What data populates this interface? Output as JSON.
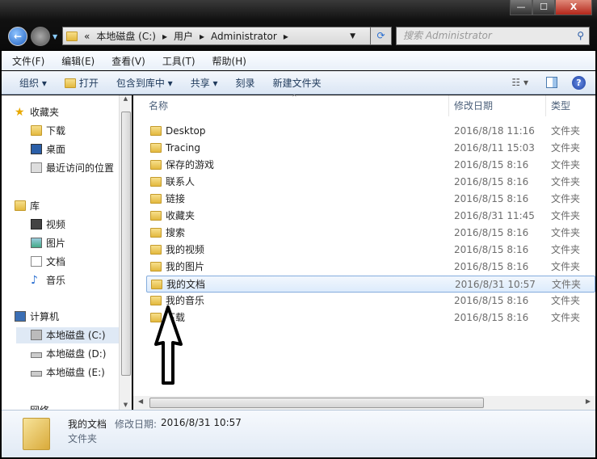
{
  "window": {
    "min": "—",
    "max": "☐",
    "close": "X"
  },
  "address": {
    "prefix": "«",
    "crumbs": [
      "本地磁盘 (C:)",
      "用户",
      "Administrator"
    ],
    "sep": "▸",
    "search_placeholder": "搜索 Administrator"
  },
  "menu": [
    "文件(F)",
    "编辑(E)",
    "查看(V)",
    "工具(T)",
    "帮助(H)"
  ],
  "toolbar": {
    "organize": "组织 ▾",
    "open": "打开",
    "include": "包含到库中 ▾",
    "share": "共享 ▾",
    "burn": "刻录",
    "new_folder": "新建文件夹",
    "help": "?"
  },
  "nav": {
    "favorites": "收藏夹",
    "downloads": "下载",
    "desktop": "桌面",
    "recent": "最近访问的位置",
    "libraries": "库",
    "videos": "视频",
    "pictures": "图片",
    "documents": "文档",
    "music": "音乐",
    "computer": "计算机",
    "c": "本地磁盘 (C:)",
    "d": "本地磁盘 (D:)",
    "e": "本地磁盘 (E:)",
    "network": "网络"
  },
  "columns": {
    "name": "名称",
    "date": "修改日期",
    "type": "类型"
  },
  "files": [
    {
      "name": "Desktop",
      "date": "2016/8/18 11:16",
      "type": "文件夹"
    },
    {
      "name": "Tracing",
      "date": "2016/8/11 15:03",
      "type": "文件夹"
    },
    {
      "name": "保存的游戏",
      "date": "2016/8/15 8:16",
      "type": "文件夹"
    },
    {
      "name": "联系人",
      "date": "2016/8/15 8:16",
      "type": "文件夹"
    },
    {
      "name": "链接",
      "date": "2016/8/15 8:16",
      "type": "文件夹"
    },
    {
      "name": "收藏夹",
      "date": "2016/8/31 11:45",
      "type": "文件夹"
    },
    {
      "name": "搜索",
      "date": "2016/8/15 8:16",
      "type": "文件夹"
    },
    {
      "name": "我的视频",
      "date": "2016/8/15 8:16",
      "type": "文件夹"
    },
    {
      "name": "我的图片",
      "date": "2016/8/15 8:16",
      "type": "文件夹"
    },
    {
      "name": "我的文档",
      "date": "2016/8/31 10:57",
      "type": "文件夹"
    },
    {
      "name": "我的音乐",
      "date": "2016/8/15 8:16",
      "type": "文件夹"
    },
    {
      "name": "下载",
      "date": "2016/8/15 8:16",
      "type": "文件夹"
    }
  ],
  "status": {
    "name": "我的文档",
    "date_label": "修改日期:",
    "date": "2016/8/31 10:57",
    "type": "文件夹"
  }
}
